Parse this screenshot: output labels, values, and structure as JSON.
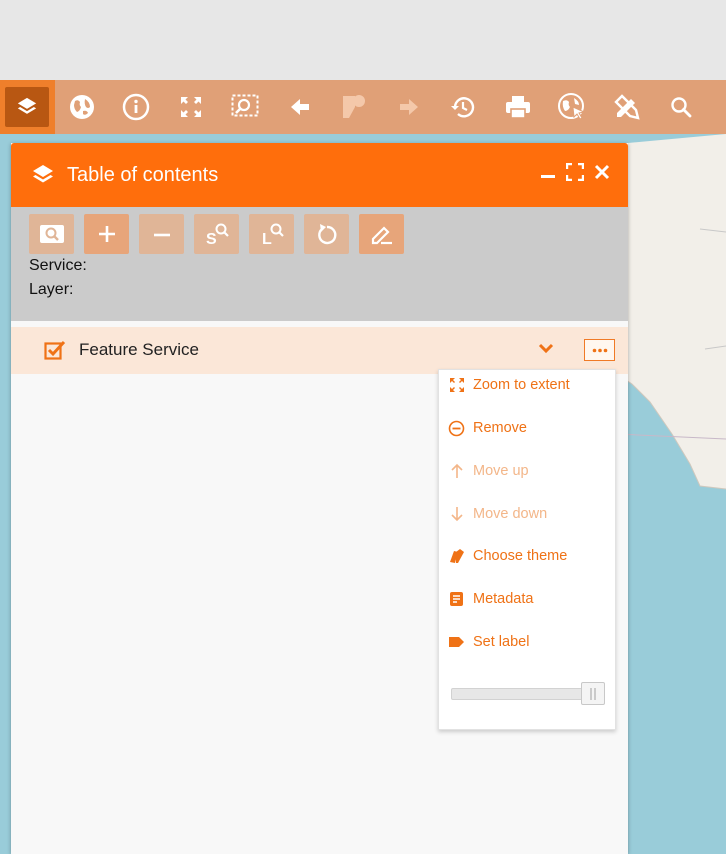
{
  "toolbar": {
    "items": [
      {
        "name": "layers-icon",
        "active": true
      },
      {
        "name": "globe-icon"
      },
      {
        "name": "info-icon"
      },
      {
        "name": "full-extent-icon"
      },
      {
        "name": "zoom-box-icon"
      },
      {
        "name": "back-arrow-icon"
      },
      {
        "name": "shapes-icon"
      },
      {
        "name": "forward-arrow-icon"
      },
      {
        "name": "history-icon"
      },
      {
        "name": "print-icon"
      },
      {
        "name": "globe-pointer-icon"
      },
      {
        "name": "tools-icon"
      },
      {
        "name": "search-icon"
      }
    ]
  },
  "panel": {
    "title": "Table of contents",
    "service_label": "Service:",
    "layer_label": "Layer:",
    "tools": [
      {
        "name": "search-service-icon",
        "enabled": false
      },
      {
        "name": "add-icon",
        "enabled": true
      },
      {
        "name": "remove-icon",
        "enabled": false
      },
      {
        "name": "search-s-icon",
        "enabled": false
      },
      {
        "name": "search-l-icon",
        "enabled": false
      },
      {
        "name": "refresh-icon",
        "enabled": false
      },
      {
        "name": "edit-icon",
        "enabled": true
      }
    ]
  },
  "layer": {
    "name": "Feature Service",
    "checked": true
  },
  "menu": {
    "items": [
      {
        "label": "Zoom to extent",
        "icon": "extent-icon",
        "enabled": true
      },
      {
        "label": "Remove",
        "icon": "minus-circle-icon",
        "enabled": true
      },
      {
        "label": "Move up",
        "icon": "arrow-up-icon",
        "enabled": false
      },
      {
        "label": "Move down",
        "icon": "arrow-down-icon",
        "enabled": false
      },
      {
        "label": "Choose theme",
        "icon": "palette-icon",
        "enabled": true
      },
      {
        "label": "Metadata",
        "icon": "document-icon",
        "enabled": true
      },
      {
        "label": "Set label",
        "icon": "label-icon",
        "enabled": true
      }
    ],
    "opacity": 1.0
  },
  "colors": {
    "accent": "#ff6e0c",
    "toolbar": "#e0a077",
    "map_water": "#99ccd9",
    "map_land": "#f2efe9"
  }
}
